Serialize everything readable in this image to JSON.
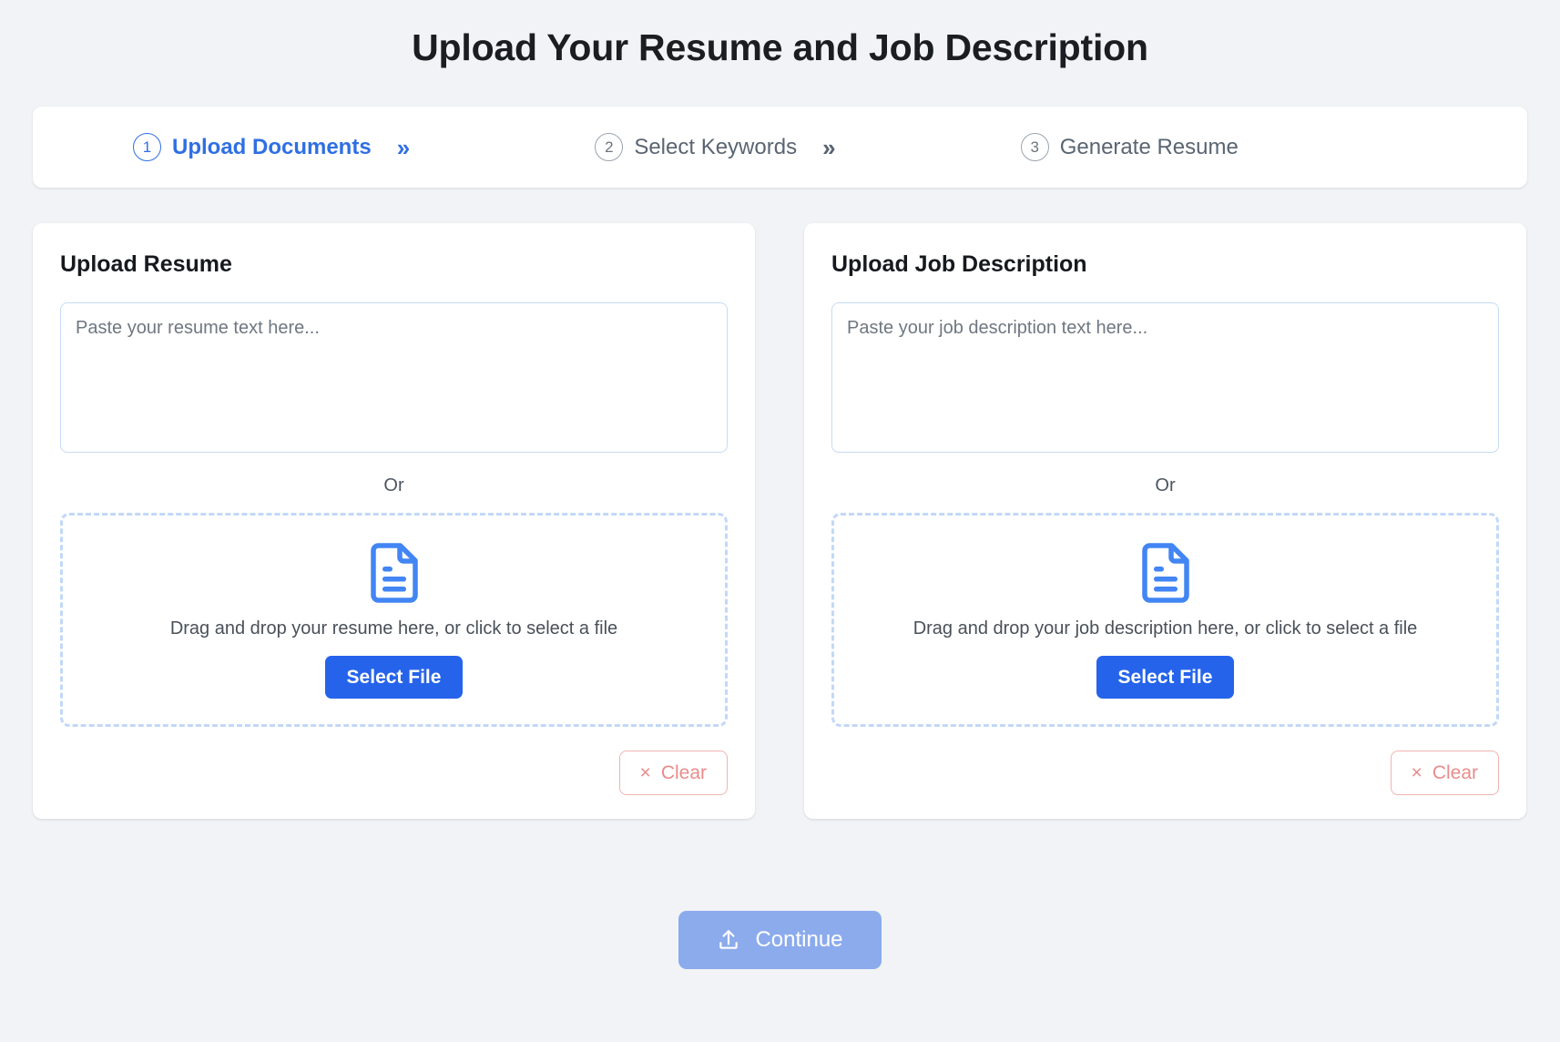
{
  "header": {
    "title": "Upload Your Resume and Job Description"
  },
  "stepper": {
    "steps": [
      {
        "number": "1",
        "label": "Upload Documents",
        "chevron": "»",
        "active": true
      },
      {
        "number": "2",
        "label": "Select Keywords",
        "chevron": "»",
        "active": false
      },
      {
        "number": "3",
        "label": "Generate Resume",
        "chevron": "",
        "active": false
      }
    ]
  },
  "resume_card": {
    "title": "Upload Resume",
    "textarea_placeholder": "Paste your resume text here...",
    "textarea_value": "",
    "or_label": "Or",
    "dropzone_text": "Drag and drop your resume here, or click to select a file",
    "select_file_label": "Select File",
    "clear_label": "Clear",
    "clear_icon": "×",
    "doc_icon": "document-icon"
  },
  "job_card": {
    "title": "Upload Job Description",
    "textarea_placeholder": "Paste your job description text here...",
    "textarea_value": "",
    "or_label": "Or",
    "dropzone_text": "Drag and drop your job description here, or click to select a file",
    "select_file_label": "Select File",
    "clear_label": "Clear",
    "clear_icon": "×",
    "doc_icon": "document-icon"
  },
  "footer": {
    "continue_label": "Continue",
    "continue_icon": "upload-icon",
    "continue_disabled": true
  },
  "colors": {
    "background": "#f1f3f6",
    "card": "#ffffff",
    "accent_blue": "#2563eb",
    "step_active": "#2f6fe4",
    "step_inactive": "#6b747e",
    "textarea_border": "#c5dbf3",
    "dropzone_border": "#c2d8f8",
    "clear_red": "#e98c8c",
    "continue_disabled": "#8cabed"
  }
}
